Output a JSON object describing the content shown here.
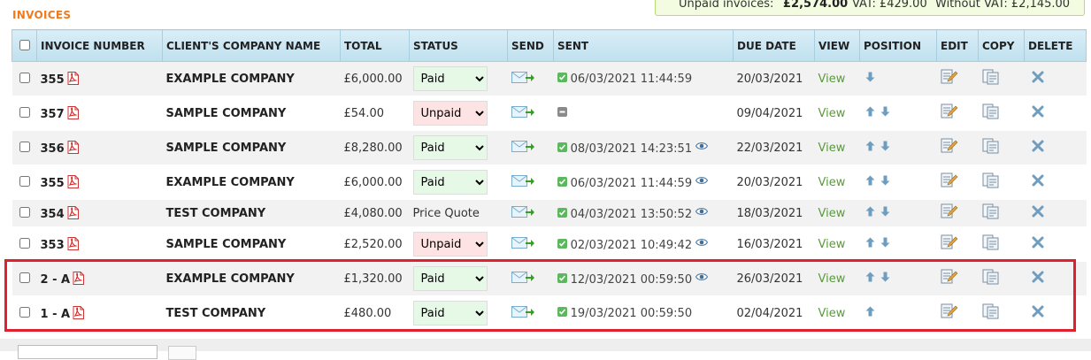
{
  "section_title": "INVOICES",
  "summary": {
    "unpaid_label": "Unpaid invoices:",
    "unpaid_value": "£2,574.00",
    "vat_text": "VAT: £429.00",
    "without_vat_text": "Without VAT: £2,145.00"
  },
  "columns": {
    "invoice_number": "INVOICE NUMBER",
    "client": "CLIENT'S COMPANY NAME",
    "total": "TOTAL",
    "status": "STATUS",
    "send": "SEND",
    "sent": "SENT",
    "due_date": "DUE DATE",
    "view": "VIEW",
    "position": "POSITION",
    "edit": "EDIT",
    "copy": "COPY",
    "delete": "DELETE"
  },
  "rows": [
    {
      "number": "355",
      "client": "EXAMPLE COMPANY",
      "total": "£6,000.00",
      "status": "Paid",
      "sent": "06/03/2021 11:44:59",
      "due": "20/03/2021",
      "view": "View"
    },
    {
      "number": "357",
      "client": "SAMPLE COMPANY",
      "total": "£54.00",
      "status": "Unpaid",
      "sent": "",
      "due": "09/04/2021",
      "view": "View"
    },
    {
      "number": "356",
      "client": "SAMPLE COMPANY",
      "total": "£8,280.00",
      "status": "Paid",
      "sent": "08/03/2021 14:23:51",
      "due": "22/03/2021",
      "view": "View"
    },
    {
      "number": "355",
      "client": "EXAMPLE COMPANY",
      "total": "£6,000.00",
      "status": "Paid",
      "sent": "06/03/2021 11:44:59",
      "due": "20/03/2021",
      "view": "View"
    },
    {
      "number": "354",
      "client": "TEST COMPANY",
      "total": "£4,080.00",
      "status": "Price Quote",
      "sent": "04/03/2021 13:50:52",
      "due": "18/03/2021",
      "view": "View"
    },
    {
      "number": "353",
      "client": "SAMPLE COMPANY",
      "total": "£2,520.00",
      "status": "Unpaid",
      "sent": "02/03/2021 10:49:42",
      "due": "16/03/2021",
      "view": "View"
    },
    {
      "number": "2 - A",
      "client": "EXAMPLE COMPANY",
      "total": "£1,320.00",
      "status": "Paid",
      "sent": "12/03/2021 00:59:50",
      "due": "26/03/2021",
      "view": "View"
    },
    {
      "number": "1 - A",
      "client": "TEST COMPANY",
      "total": "£480.00",
      "status": "Paid",
      "sent": "19/03/2021 00:59:50",
      "due": "02/04/2021",
      "view": "View"
    }
  ],
  "status_options": [
    "Paid",
    "Unpaid"
  ],
  "colors": {
    "accent": "#f07a1a",
    "header_bg": "#c8e4f1",
    "view_link": "#5a9a3c",
    "highlight": "#e0202c",
    "paid_bg": "#e6f9e6",
    "unpaid_bg": "#fde3e3"
  }
}
